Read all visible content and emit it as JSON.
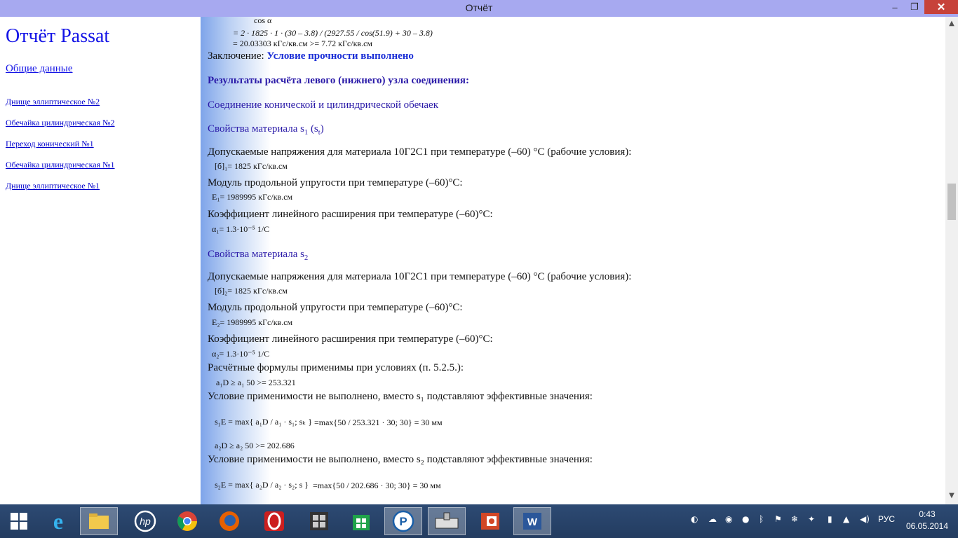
{
  "window": {
    "title": "Отчёт",
    "minimize": "–",
    "maximize": "❐",
    "close": "✕"
  },
  "sidebar": {
    "title": "Отчёт Passat",
    "general": "Общие данные",
    "items": [
      "Днище эллиптическое №2",
      "Обечайка цилиндрическая №2",
      "Переход конический №1",
      "Обечайка цилиндрическая №1",
      "Днище эллиптическое №1"
    ]
  },
  "content": {
    "cos_top": "cos α",
    "formula_line1": "=    2 · 1825 · 1 · (30 – 3.8) / (2927.55 / cos(51.9) + 30 – 3.8)",
    "formula_line2": "=    20.03303 кГс/кв.см >= 7.72 кГс/кв.см",
    "conclusion_label": "Заключение: ",
    "conclusion_value": "Условие прочности выполнено",
    "results_heading": "Результаты расчёта левого (нижнего) узла соединения:",
    "connection_heading": "Соединение конической и цилиндрической обечаек",
    "mat1_heading": "Свойства материала s",
    "mat1_sub": "1",
    "mat1_paren": " (s",
    "mat1_paren_sub": "t",
    "allow1_text": "Допускаемые напряжения для материала 10Г2С1 при температуре (–60) °С (рабочие условия):",
    "allow1_val": "[б]₁=    1825 кГс/кв.см",
    "mod1_text": "Модуль продольной упругости при температуре (–60)°С:",
    "mod1_val": "E₁=    1989995 кГс/кв.см",
    "coef1_text": "Коэффициент линейного расширения при температуре (–60)°С:",
    "coef1_val": "α₁=    1.3·10⁻⁵ 1/С",
    "mat2_heading": "Свойства материала s",
    "mat2_sub": "2",
    "allow2_text": "Допускаемые напряжения для материала 10Г2С1 при температуре (–60) °С (рабочие условия):",
    "allow2_val": "[б]₂=    1825 кГс/кв.см",
    "mod2_text": "Модуль продольной упругости при температуре (–60)°С:",
    "mod2_val": "E₂=    1989995 кГс/кв.см",
    "coef2_text": "Коэффициент линейного расширения при температуре (–60)°С:",
    "coef2_val": "α₂=    1.3·10⁻⁵ 1/С",
    "formulas_applicable": "Расчётные формулы применимы при условиях (п. 5.2.5.):",
    "cond1": "a₁D ≥ a₁     50 >= 253.321",
    "notmet1_text": "Условие применимости не выполнено, вместо s₁ подставляют эффективные значения:",
    "s1e_formula": "s₁E = max{ a₁D / a₁ · s₁; sₖ }",
    "s1e_val": "=max{50 / 253.321 · 30; 30} = 30 мм",
    "cond2": "a₂D ≥ a₂     50 >= 202.686",
    "notmet2_text": "Условие применимости не выполнено, вместо s₂ подставляют эффективные значения:",
    "s2e_formula": "s₂E = max{ a₂D / a₂ · s₂; s }",
    "s2e_val": "=max{50 / 202.686 · 30; 30} = 30 мм"
  },
  "taskbar": {
    "language": "РУС",
    "time": "0:43",
    "date": "06.05.2014"
  },
  "colors": {
    "titlebar": "#a7a9f0",
    "link": "#0000cc",
    "heading": "#2a1aa8",
    "taskbar": "#233c60"
  }
}
